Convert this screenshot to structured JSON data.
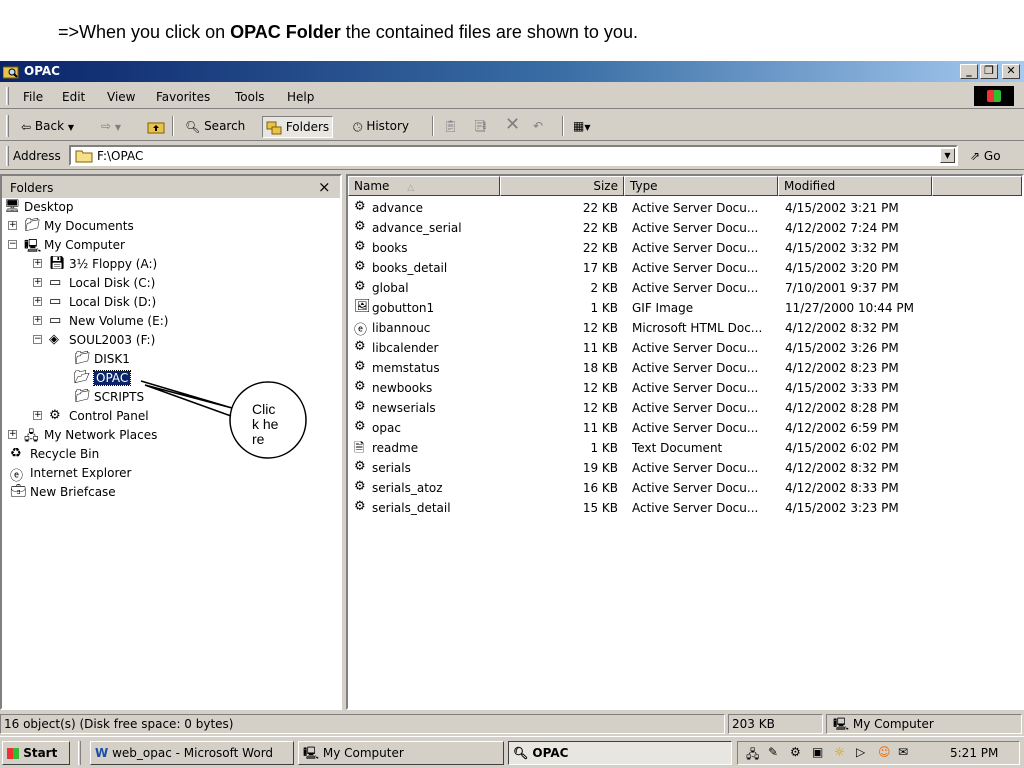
{
  "caption": {
    "prefix": "=>When you click on ",
    "bold": "OPAC Folder",
    "suffix": " the contained files are shown to you."
  },
  "window": {
    "title": "OPAC",
    "buttons": [
      "_",
      " ̱",
      "x"
    ]
  },
  "menu": [
    "File",
    "Edit",
    "View",
    "Favorites",
    "Tools",
    "Help"
  ],
  "toolbar": {
    "back": "Back",
    "search": "Search",
    "folders": "Folders",
    "history": "History"
  },
  "address": {
    "label": "Address",
    "value": "F:\\OPAC",
    "go": "Go"
  },
  "folders_pane": {
    "title": "Folders",
    "close": "×",
    "tree": [
      {
        "label": "Desktop",
        "icon": "desktop-icon"
      },
      {
        "label": "My Documents",
        "icon": "my-documents-icon"
      },
      {
        "label": "My Computer",
        "icon": "my-computer-icon"
      },
      {
        "label": "3½ Floppy (A:)",
        "icon": "floppy-icon"
      },
      {
        "label": "Local Disk (C:)",
        "icon": "disk-icon"
      },
      {
        "label": "Local Disk (D:)",
        "icon": "disk-icon"
      },
      {
        "label": "New Volume (E:)",
        "icon": "disk-icon"
      },
      {
        "label": "SOUL2003 (F:)",
        "icon": "cd-icon"
      },
      {
        "label": "DISK1",
        "icon": "folder-icon"
      },
      {
        "label": "OPAC",
        "icon": "folder-open-icon"
      },
      {
        "label": "SCRIPTS",
        "icon": "folder-icon"
      },
      {
        "label": "Control Panel",
        "icon": "control-panel-icon"
      },
      {
        "label": "My Network Places",
        "icon": "network-icon"
      },
      {
        "label": "Recycle Bin",
        "icon": "recycle-bin-icon"
      },
      {
        "label": "Internet Explorer",
        "icon": "ie-icon"
      },
      {
        "label": "New Briefcase",
        "icon": "briefcase-icon"
      }
    ]
  },
  "files_pane": {
    "columns": [
      "Name",
      "Size",
      "Type",
      "Modified"
    ],
    "rows": [
      {
        "name": "advance",
        "size": "22 KB",
        "type": "Active Server Docu...",
        "modified": "4/15/2002 3:21 PM",
        "icon": "asp-icon"
      },
      {
        "name": "advance_serial",
        "size": "22 KB",
        "type": "Active Server Docu...",
        "modified": "4/12/2002 7:24 PM",
        "icon": "asp-icon"
      },
      {
        "name": "books",
        "size": "22 KB",
        "type": "Active Server Docu...",
        "modified": "4/15/2002 3:32 PM",
        "icon": "asp-icon"
      },
      {
        "name": "books_detail",
        "size": "17 KB",
        "type": "Active Server Docu...",
        "modified": "4/15/2002 3:20 PM",
        "icon": "asp-icon"
      },
      {
        "name": "global",
        "size": "2 KB",
        "type": "Active Server Docu...",
        "modified": "7/10/2001 9:37 PM",
        "icon": "asp-icon"
      },
      {
        "name": "gobutton1",
        "size": "1 KB",
        "type": "GIF Image",
        "modified": "11/27/2000 10:44 PM",
        "icon": "gif-icon"
      },
      {
        "name": "libannouc",
        "size": "12 KB",
        "type": "Microsoft HTML Doc...",
        "modified": "4/12/2002 8:32 PM",
        "icon": "html-icon"
      },
      {
        "name": "libcalender",
        "size": "11 KB",
        "type": "Active Server Docu...",
        "modified": "4/15/2002 3:26 PM",
        "icon": "asp-icon"
      },
      {
        "name": "memstatus",
        "size": "18 KB",
        "type": "Active Server Docu...",
        "modified": "4/12/2002 8:23 PM",
        "icon": "asp-icon"
      },
      {
        "name": "newbooks",
        "size": "12 KB",
        "type": "Active Server Docu...",
        "modified": "4/15/2002 3:33 PM",
        "icon": "asp-icon"
      },
      {
        "name": "newserials",
        "size": "12 KB",
        "type": "Active Server Docu...",
        "modified": "4/12/2002 8:28 PM",
        "icon": "asp-icon"
      },
      {
        "name": "opac",
        "size": "11 KB",
        "type": "Active Server Docu...",
        "modified": "4/12/2002 6:59 PM",
        "icon": "asp-icon"
      },
      {
        "name": "readme",
        "size": "1 KB",
        "type": "Text Document",
        "modified": "4/15/2002 6:02 PM",
        "icon": "text-icon"
      },
      {
        "name": "serials",
        "size": "19 KB",
        "type": "Active Server Docu...",
        "modified": "4/12/2002 8:32 PM",
        "icon": "asp-icon"
      },
      {
        "name": "serials_atoz",
        "size": "16 KB",
        "type": "Active Server Docu...",
        "modified": "4/12/2002 8:33 PM",
        "icon": "asp-icon"
      },
      {
        "name": "serials_detail",
        "size": "15 KB",
        "type": "Active Server Docu...",
        "modified": "4/15/2002 3:23 PM",
        "icon": "asp-icon"
      }
    ]
  },
  "status": {
    "objects": "16 object(s) (Disk free space: 0 bytes)",
    "size": "203 KB",
    "zone": "My Computer"
  },
  "taskbar": {
    "start": "Start",
    "tasks": [
      "web_opac - Microsoft Word",
      "My Computer",
      "OPAC"
    ],
    "clock": "5:21 PM"
  },
  "callout": {
    "text": "Click here"
  },
  "colors": {
    "title_active": "#0a246a",
    "face": "#d4d0c8",
    "selection": "#0a246a"
  }
}
